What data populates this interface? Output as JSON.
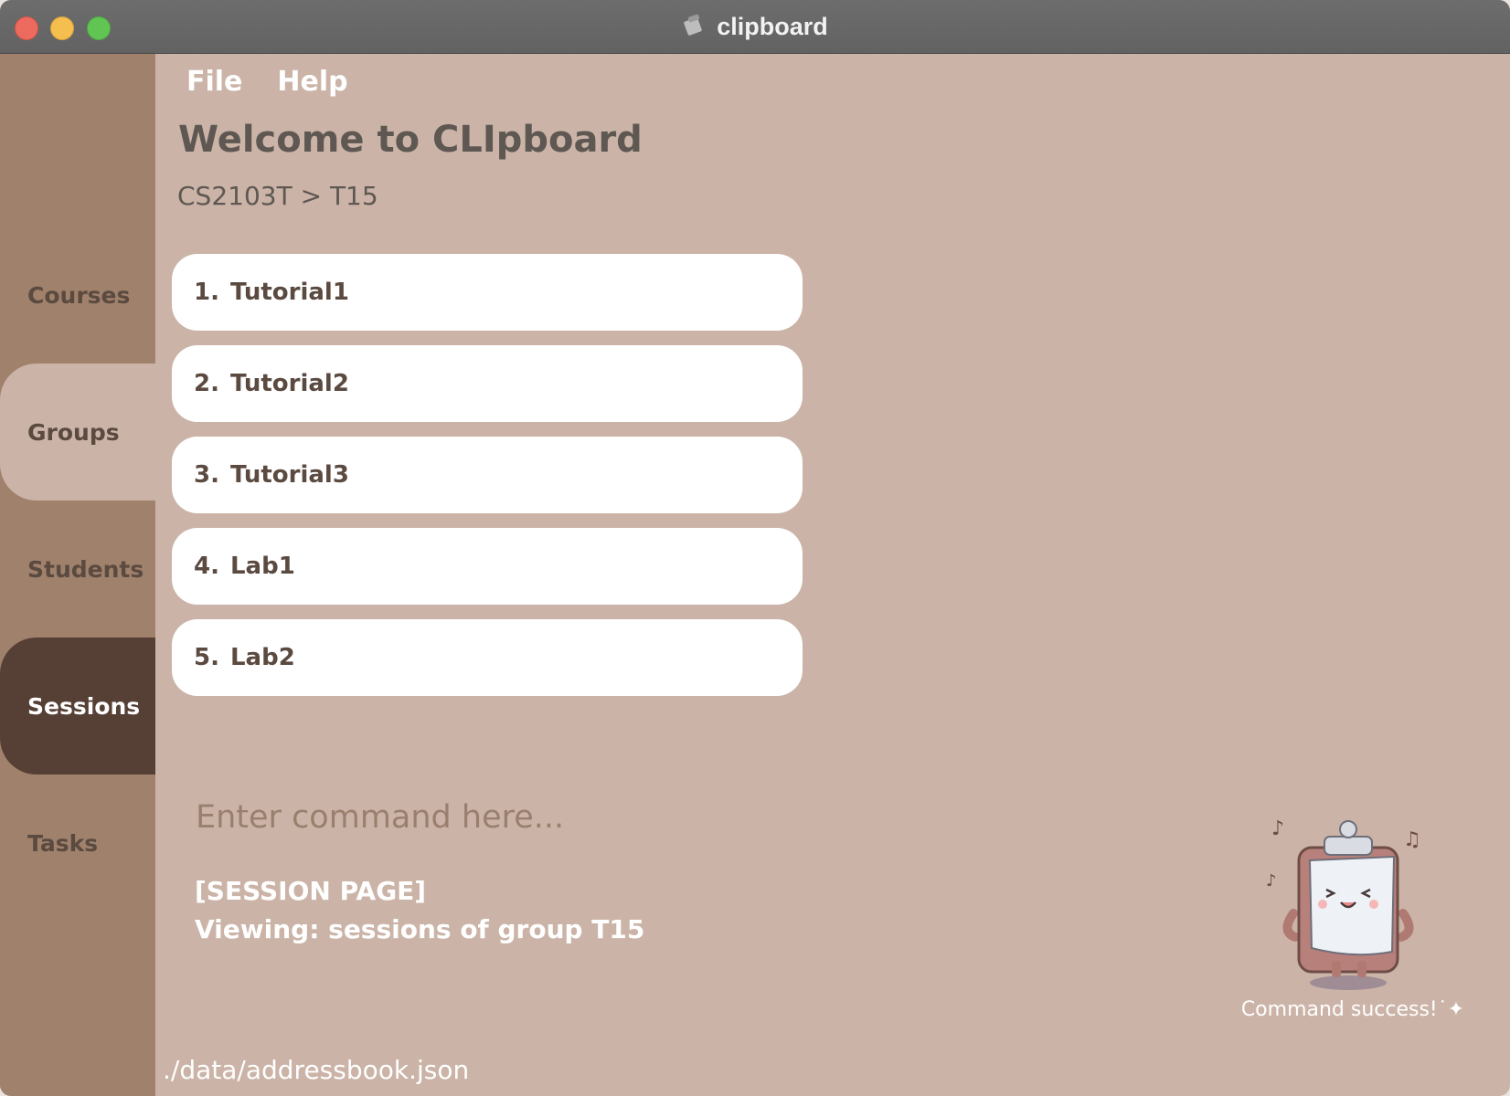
{
  "window": {
    "title": "clipboard"
  },
  "menu": {
    "items": [
      "File",
      "Help"
    ]
  },
  "sidebar": {
    "tabs": [
      {
        "label": "Courses",
        "state": "normal"
      },
      {
        "label": "Groups",
        "state": "selected"
      },
      {
        "label": "Students",
        "state": "normal"
      },
      {
        "label": "Sessions",
        "state": "active"
      },
      {
        "label": "Tasks",
        "state": "normal"
      }
    ]
  },
  "main": {
    "welcome": "Welcome to CLIpboard",
    "breadcrumb": "CS2103T > T15",
    "sessions": [
      {
        "index": "1.",
        "name": "Tutorial1"
      },
      {
        "index": "2.",
        "name": "Tutorial2"
      },
      {
        "index": "3.",
        "name": "Tutorial3"
      },
      {
        "index": "4.",
        "name": "Lab1"
      },
      {
        "index": "5.",
        "name": "Lab2"
      }
    ]
  },
  "command": {
    "placeholder": "Enter command here...",
    "value": ""
  },
  "result": {
    "line1": "[SESSION PAGE]",
    "line2": "Viewing: sessions of group T15"
  },
  "mascot": {
    "icon": "clipboard-mascot-icon",
    "caption": "Command success!˙✦"
  },
  "status": {
    "file_path": "./data/addressbook.json"
  },
  "colors": {
    "background": "#cbb4a7",
    "sidebar": "#a0816c",
    "active_tab": "#563f35",
    "card": "#ffffff",
    "text_dark": "#5b4a40"
  }
}
